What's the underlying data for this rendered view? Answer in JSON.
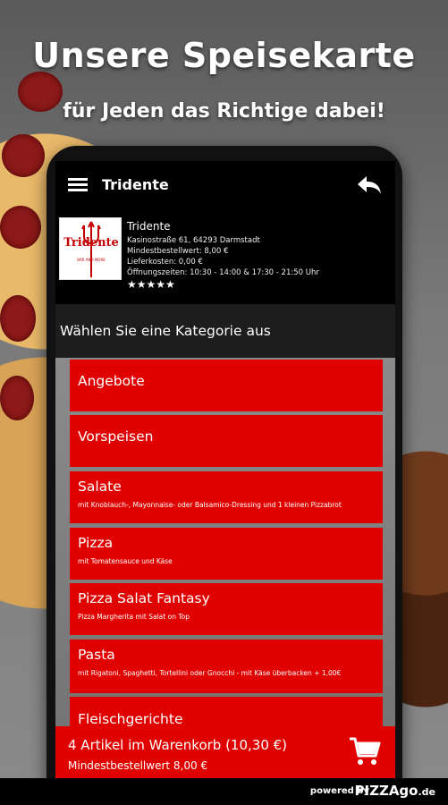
{
  "promo": {
    "headline": "Unsere Speisekarte",
    "subline": "für Jeden das Richtige dabei!"
  },
  "app_bar": {
    "title": "Tridente",
    "menu_icon": "hamburger-menu-icon",
    "back_icon": "back-arrow-icon"
  },
  "restaurant": {
    "logo_text": "Tridente",
    "logo_subtext": "BAR AND MORE",
    "name": "Tridente",
    "address": "Kasinostraße 61, 64293 Darmstadt",
    "min_order": "Mindestbestellwert: 8,00 €",
    "delivery_cost": "Lieferkosten: 0,00 €",
    "hours": "Öffnungszeiten: 10:30 - 14:00 & 17:30 - 21:50 Uhr",
    "rating_stars": "★★★★★",
    "rating_value": 5
  },
  "category_header": "Wählen Sie eine Kategorie aus",
  "categories": [
    {
      "title": "Angebote",
      "subtitle": ""
    },
    {
      "title": "Vorspeisen",
      "subtitle": ""
    },
    {
      "title": "Salate",
      "subtitle": "mit Knoblauch-, Mayonnaise- oder Balsamico-Dressing und 1 kleinen Pizzabrot"
    },
    {
      "title": "Pizza",
      "subtitle": "mit Tomatensauce und Käse"
    },
    {
      "title": "Pizza Salat Fantasy",
      "subtitle": "Pizza Margherita mit Salat on Top"
    },
    {
      "title": "Pasta",
      "subtitle": "mit Rigatoni, Spaghetti, Tortellini oder Gnocchi - mit Käse überbacken + 1,00€"
    },
    {
      "title": "Fleischgerichte",
      "subtitle": ""
    }
  ],
  "cart": {
    "summary": "4 Artikel im Warenkorb (10,30 €)",
    "min_order": "Mindestbestellwert 8,00 €",
    "icon": "shopping-cart-icon"
  },
  "footer": {
    "powered_by": "powered by",
    "brand_prefix": "go",
    "brand_main": "PIZZAgo",
    "brand_suffix": ".de"
  },
  "colors": {
    "accent": "#e00000",
    "bar": "#000000"
  }
}
